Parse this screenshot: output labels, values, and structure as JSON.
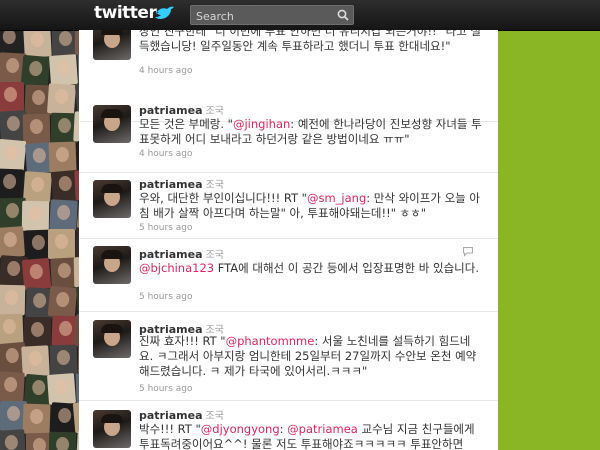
{
  "header": {
    "logo_text": "twitter",
    "search_placeholder": "Search"
  },
  "theme": {
    "mention_color": "#e0245e",
    "panel_green": "#8ab626",
    "topbar": "#1e1e1e"
  },
  "tweets": [
    {
      "username": "",
      "fullname": "",
      "text_parts": [
        {
          "t": "장인 친구한테 \"너 이번에 투표 안하면 더 유리지갑 되는거야!!\" 라고 설득했습니당! 일주일동안 계속 투표하라고 했더니 투표 한대네요!\""
        }
      ],
      "time": "4 hours ago"
    },
    {
      "username": "patriamea",
      "fullname": "조국",
      "text_parts": [
        {
          "t": "모든 것은 부메랑. \""
        },
        {
          "t": "@jingihan",
          "mention": true
        },
        {
          "t": ": 예전에 한나라당이 진보성향 자녀들 투표못하게 어디 보내라고 하던거랑 같은 방법이네요 ㅠㅠ\""
        }
      ],
      "time": "4 hours ago"
    },
    {
      "username": "patriamea",
      "fullname": "조국",
      "text_parts": [
        {
          "t": "우와, 대단한 부인이십니다!!! RT \""
        },
        {
          "t": "@sm_jang",
          "mention": true
        },
        {
          "t": ": 만삭 와이프가 오늘 아침 배가 살짝 아프다며 하는말\" 아, 투표해야돼는데!!\" ㅎㅎ\""
        }
      ],
      "time": "5 hours ago"
    },
    {
      "username": "patriamea",
      "fullname": "조국",
      "text_parts": [
        {
          "t": "@bjchina123",
          "mention": true
        },
        {
          "t": " FTA에 대해선 이 공간 등에서 입장표명한 바 있습니다."
        }
      ],
      "time": "5 hours ago",
      "reply_icon": "reply-icon"
    },
    {
      "username": "patriamea",
      "fullname": "조국",
      "text_parts": [
        {
          "t": "진짜 효자!!! RT \""
        },
        {
          "t": "@phantomnme",
          "mention": true
        },
        {
          "t": ": 서울 노친네를 설득하기 힘드네요. ㅋ그래서 아부지랑 엄니한테 25일부터 27일까지 수안보 온천 예약해드렸습니다. ㅋ 제가 타국에 있어서리.ㅋㅋㅋ\""
        }
      ],
      "time": "5 hours ago"
    },
    {
      "username": "patriamea",
      "fullname": "조국",
      "text_parts": [
        {
          "t": "박수!!! RT \""
        },
        {
          "t": "@djyongyong",
          "mention": true
        },
        {
          "t": ": "
        },
        {
          "t": "@patriamea",
          "mention": true
        },
        {
          "t": " 교수님 지금 친구들에게 투표독려중이어요^^! 물론 저도 투표해야죠ㅋㅋㅋㅋㅋ 투표안하면"
        }
      ],
      "time": ""
    }
  ]
}
